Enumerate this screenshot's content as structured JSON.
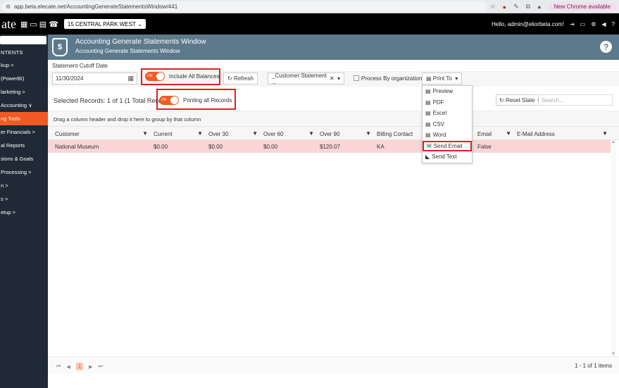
{
  "browser": {
    "url": "app.beta.elecate.net/AccountingGenerateStatementsWindow/441",
    "new_chrome": "New Chrome available"
  },
  "appbar": {
    "logo": "ate",
    "location": "15 CENTRAL PARK WEST",
    "greeting": "Hello, admin@eliorbeta.com!"
  },
  "sidebar": {
    "contents": "NTENTS",
    "items": [
      {
        "label": "kup  >"
      },
      {
        "label": "(PowerBI)"
      },
      {
        "label": "larketing  >"
      },
      {
        "label": "Accounting  ∨"
      },
      {
        "label": "ng Tools"
      },
      {
        "label": "er Financials  >"
      },
      {
        "label": "al Reports"
      },
      {
        "label": "sions & Goals"
      },
      {
        "label": "Processing  >"
      },
      {
        "label": "n  >"
      },
      {
        "label": "s  >"
      },
      {
        "label": "etup  >"
      }
    ]
  },
  "header": {
    "title": "Accounting Generate Statements Window",
    "subtitle": "Accounting Generate Statements Window",
    "help": "?"
  },
  "form": {
    "cutoff_label": "Statement Cutoff Date",
    "cutoff_value": "11/30/2024",
    "toggle_on": "ON",
    "include_all_balances": "Include All Balances",
    "refresh": "Refresh",
    "statement_combo": "_Customer Statement ...",
    "process_by_org": "Process By organization",
    "print_to": "Print To",
    "selected_records": "Selected Records: 1 of 1 (1 Total Records)",
    "printing_all_records": "Printing all Records",
    "reset_state": "Reset State",
    "search_placeholder": "Search...",
    "group_hint": "Drag a column header and drop it here to group by that column"
  },
  "print_menu": [
    {
      "label": "Preview",
      "icon": "document-icon"
    },
    {
      "label": "PDF",
      "icon": "document-icon"
    },
    {
      "label": "Excel",
      "icon": "document-icon"
    },
    {
      "label": "CSV",
      "icon": "document-icon"
    },
    {
      "label": "Word",
      "icon": "document-icon"
    },
    {
      "label": "Send Email",
      "icon": "email-icon"
    },
    {
      "label": "Send Text",
      "icon": "rss-icon"
    }
  ],
  "grid": {
    "columns": [
      "Customer",
      "Current",
      "Over 30",
      "Over 60",
      "Over 90",
      "Billing Contact",
      "Email",
      "E-Mail Address"
    ],
    "rows": [
      {
        "customer": "National Museum",
        "current": "$0.00",
        "over30": "$0.00",
        "over60": "$0.00",
        "over90": "$120.07",
        "billing_contact": "KA",
        "email": "False",
        "email_address": ""
      }
    ]
  },
  "pager": {
    "page": "1",
    "info": "1 - 1 of 1 items"
  },
  "colors": {
    "accent": "#f15a24",
    "header_bg": "#5d7a8c",
    "highlight_border": "#e0201f",
    "row_selected": "#fbd5d5"
  }
}
